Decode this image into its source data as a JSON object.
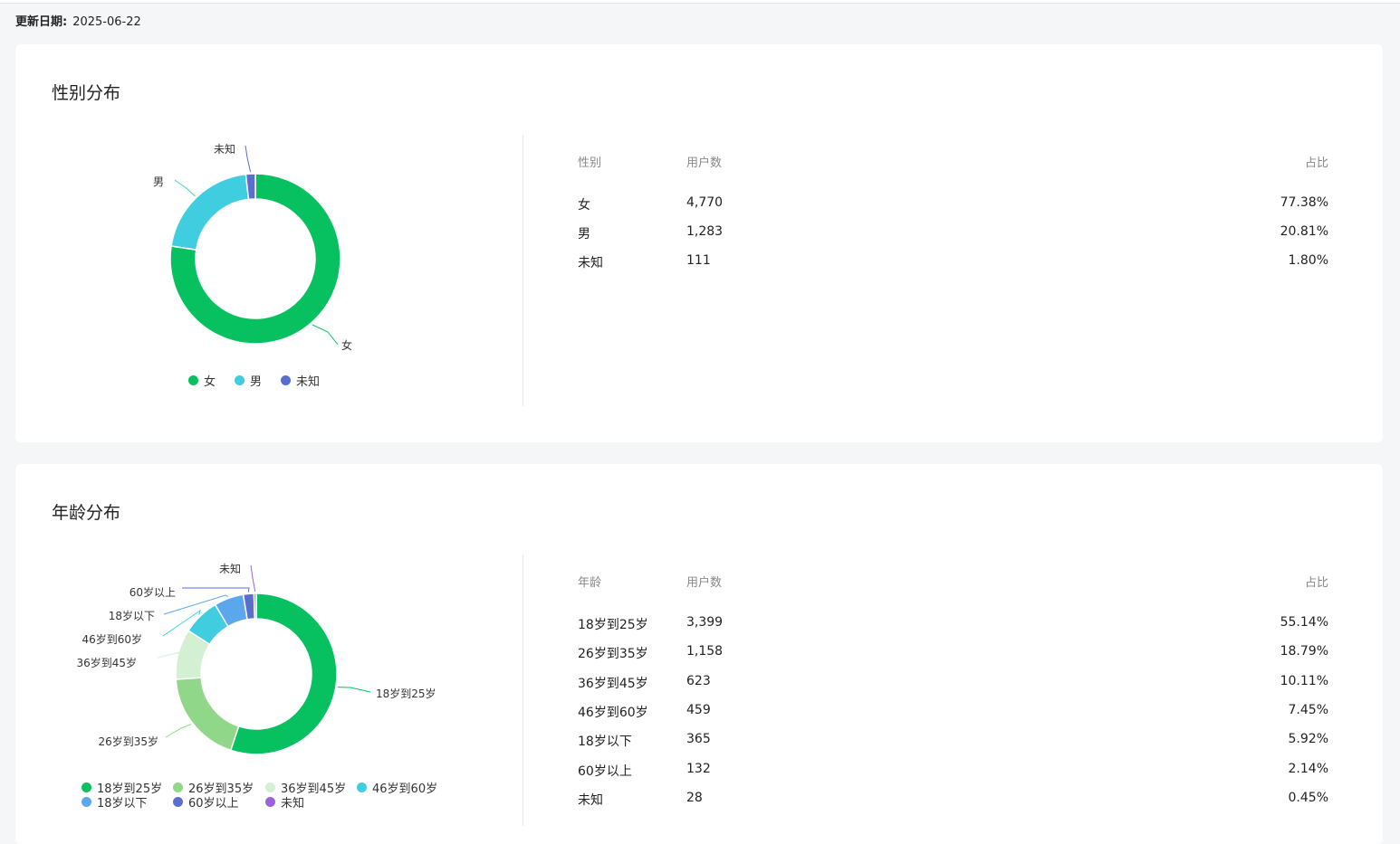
{
  "header": {
    "update_label": "更新日期:",
    "update_date": "2025-06-22"
  },
  "gender": {
    "title": "性别分布",
    "table_headers": [
      "性别",
      "用户数",
      "占比"
    ],
    "rows": [
      {
        "name": "女",
        "count": "4,770",
        "pct": "77.38%"
      },
      {
        "name": "男",
        "count": "1,283",
        "pct": "20.81%"
      },
      {
        "name": "未知",
        "count": "111",
        "pct": "1.80%"
      }
    ]
  },
  "age": {
    "title": "年龄分布",
    "table_headers": [
      "年龄",
      "用户数",
      "占比"
    ],
    "rows": [
      {
        "name": "18岁到25岁",
        "count": "3,399",
        "pct": "55.14%"
      },
      {
        "name": "26岁到35岁",
        "count": "1,158",
        "pct": "18.79%"
      },
      {
        "name": "36岁到45岁",
        "count": "623",
        "pct": "10.11%"
      },
      {
        "name": "46岁到60岁",
        "count": "459",
        "pct": "7.45%"
      },
      {
        "name": "18岁以下",
        "count": "365",
        "pct": "5.92%"
      },
      {
        "name": "60岁以上",
        "count": "132",
        "pct": "2.14%"
      },
      {
        "name": "未知",
        "count": "28",
        "pct": "0.45%"
      }
    ]
  },
  "chart_data": [
    {
      "type": "pie",
      "variant": "donut",
      "categories": [
        "女",
        "男",
        "未知"
      ],
      "values": [
        4770,
        1283,
        111
      ],
      "percent": [
        77.38,
        20.81,
        1.8
      ],
      "colors": [
        "#07c160",
        "#40cde0",
        "#5b6ed0"
      ],
      "legend": {
        "position": "bottom"
      }
    },
    {
      "type": "pie",
      "variant": "donut",
      "categories": [
        "18岁到25岁",
        "26岁到35岁",
        "36岁到45岁",
        "46岁到60岁",
        "18岁以下",
        "60岁以上",
        "未知"
      ],
      "values": [
        3399,
        1158,
        623,
        459,
        365,
        132,
        28
      ],
      "percent": [
        55.14,
        18.79,
        10.11,
        7.45,
        5.92,
        2.14,
        0.45
      ],
      "colors": [
        "#07c160",
        "#91d78a",
        "#d4f0d3",
        "#40cde0",
        "#5aa7ee",
        "#5b6ed0",
        "#9a63db"
      ],
      "legend": {
        "position": "bottom"
      }
    }
  ]
}
